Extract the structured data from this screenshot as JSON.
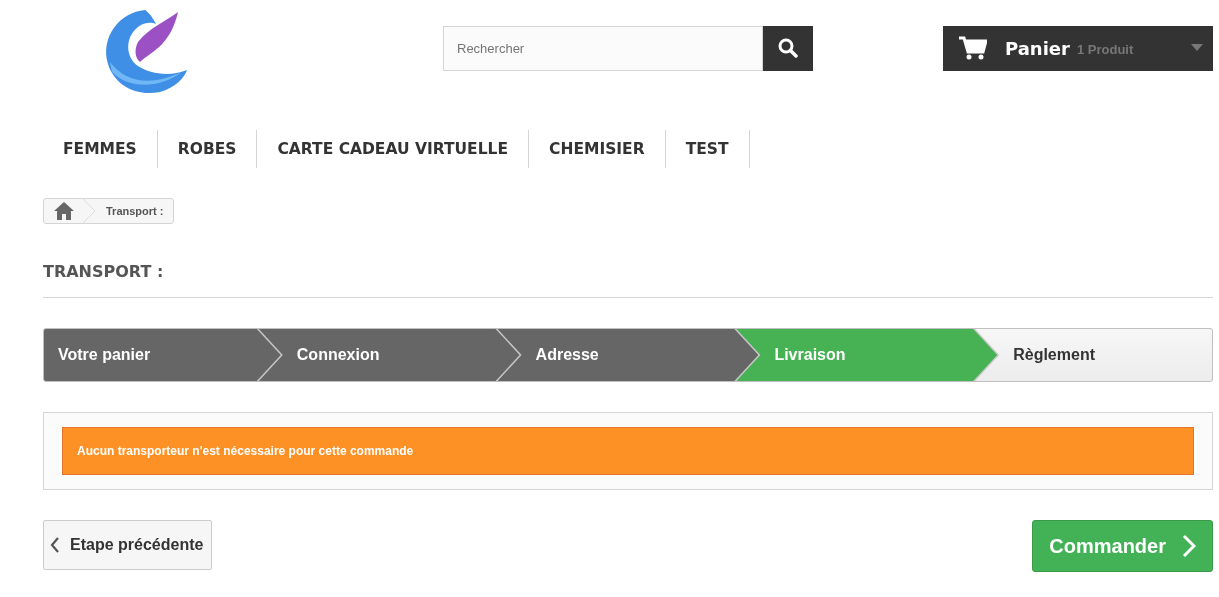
{
  "header": {
    "search": {
      "placeholder": "Rechercher"
    },
    "cart": {
      "label": "Panier",
      "count": "1 Produit"
    }
  },
  "menu": [
    "FEMMES",
    "ROBES",
    "CARTE CADEAU VIRTUELLE",
    "CHEMISIER",
    "TEST"
  ],
  "breadcrumb": [
    "Transport :"
  ],
  "page_title": "TRANSPORT :",
  "steps": [
    {
      "label": "Votre panier",
      "completed": true,
      "selected": false
    },
    {
      "label": "Connexion",
      "completed": true,
      "selected": false
    },
    {
      "label": "Adresse",
      "completed": true,
      "selected": false
    },
    {
      "label": "Livraison",
      "completed": false,
      "selected": true
    },
    {
      "label": "Règlement",
      "completed": false,
      "selected": false
    }
  ],
  "alert": "Aucun transporteur n'est nécessaire pour cette commande",
  "buttons": {
    "back": "Etape précédente",
    "next": "Commander"
  }
}
